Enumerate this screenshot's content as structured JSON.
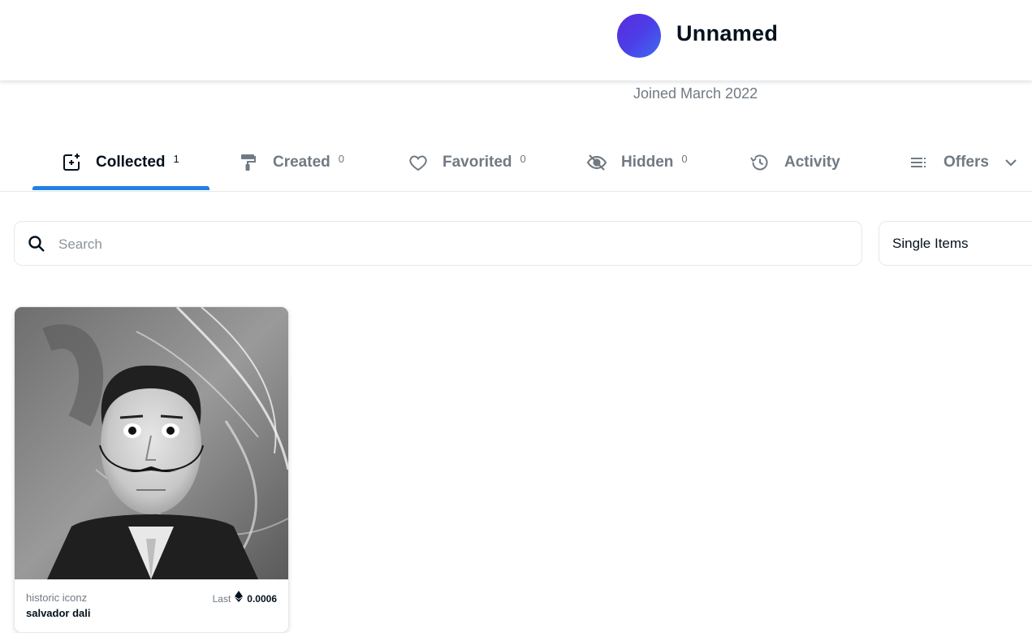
{
  "profile": {
    "name": "Unnamed",
    "joined": "Joined March 2022"
  },
  "tabs": [
    {
      "label": "Collected",
      "count": "1",
      "icon": "collected-icon",
      "active": true
    },
    {
      "label": "Created",
      "count": "0",
      "icon": "paint-roller-icon"
    },
    {
      "label": "Favorited",
      "count": "0",
      "icon": "heart-icon"
    },
    {
      "label": "Hidden",
      "count": "0",
      "icon": "eye-off-icon"
    },
    {
      "label": "Activity",
      "icon": "history-icon"
    },
    {
      "label": "Offers",
      "icon": "list-icon"
    }
  ],
  "search": {
    "placeholder": "Search"
  },
  "filter": {
    "selected": "Single Items"
  },
  "items": [
    {
      "collection": "historic iconz",
      "name": "salvador dali",
      "last_label": "Last",
      "price": "0.0006",
      "currency_icon": "ethereum-icon"
    }
  ],
  "colors": {
    "accent": "#2081e2",
    "avatar_start": "#5b2bd9",
    "avatar_end": "#3f6df0"
  }
}
